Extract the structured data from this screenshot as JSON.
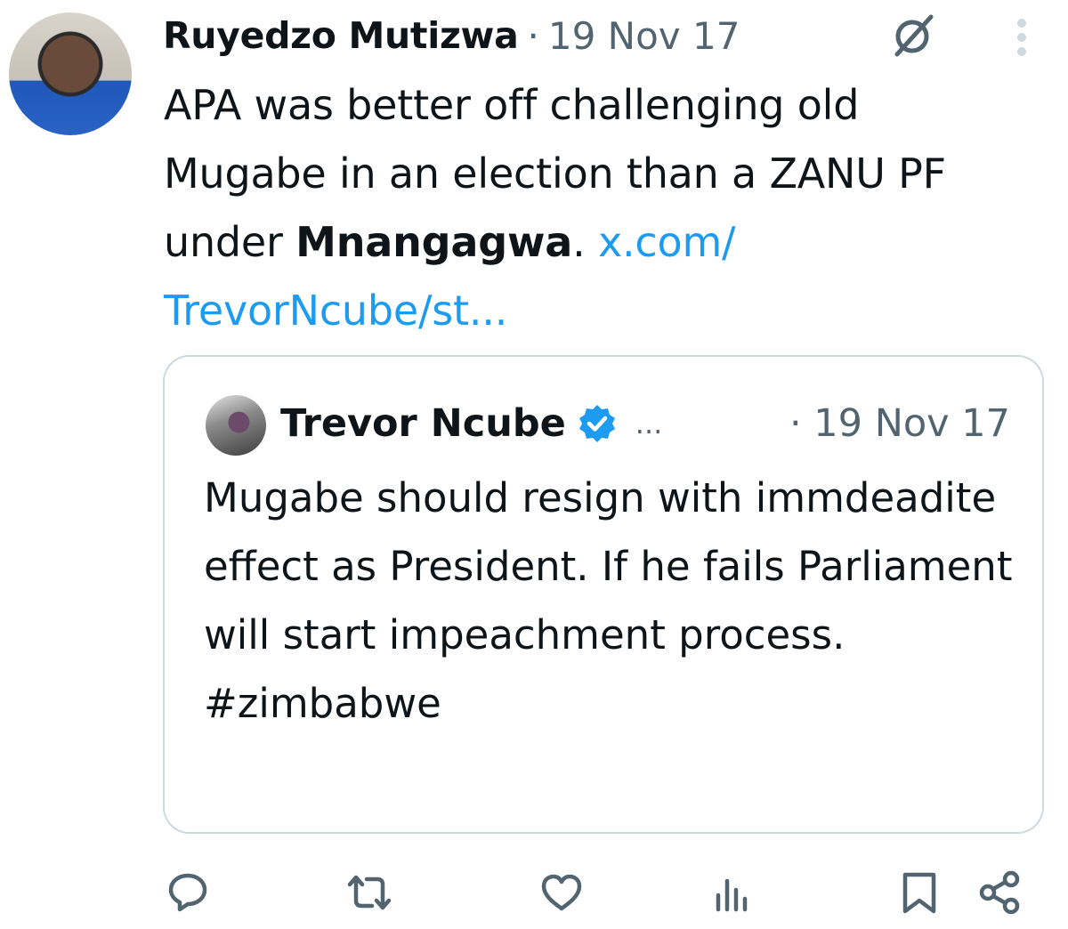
{
  "tweet": {
    "author": "Ruyedzo Mutizwa",
    "separator": "·",
    "date": "19 Nov 17",
    "text_part1": "APA was better off challenging old Mugabe in an election than a ZANU PF under ",
    "text_bold": "Mnangagwa",
    "text_part2": ". ",
    "link": "x.com/ TrevorNcube/st..."
  },
  "quote": {
    "author": "Trevor Ncube",
    "ellipsis": "...",
    "date": "· 19 Nov 17",
    "text": "Mugabe should resign with immdeadite effect as President. If he fails Parliament will start impeachment process. #zimbabwe"
  },
  "icons": {
    "header": [
      "grok-icon",
      "more-icon",
      "verified-badge-icon"
    ],
    "actions": [
      "reply-icon",
      "retweet-icon",
      "like-icon",
      "views-icon",
      "bookmark-icon",
      "share-icon"
    ]
  },
  "colors": {
    "text": "#0f1419",
    "muted": "#536471",
    "link": "#1d9bf0",
    "border": "#cfd9de"
  }
}
